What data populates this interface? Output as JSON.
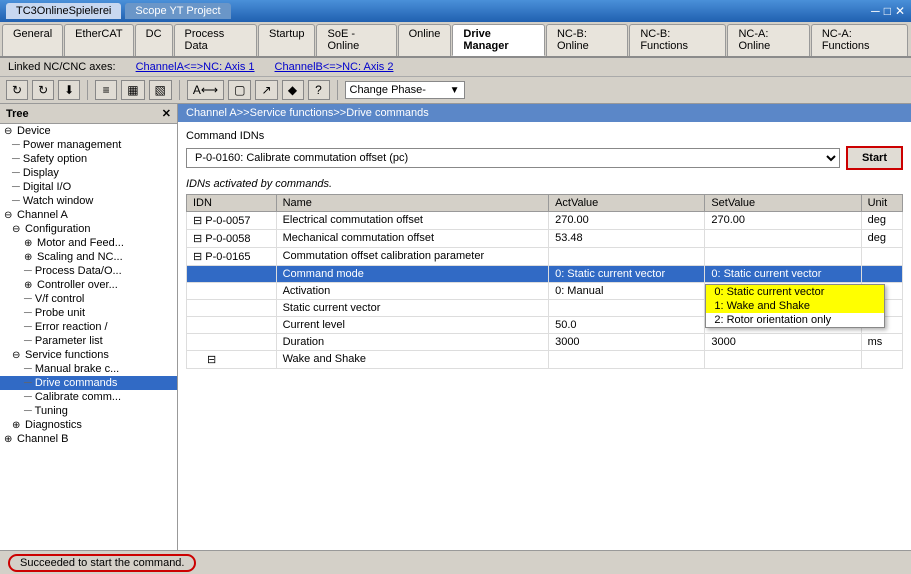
{
  "titlebar": {
    "tab1": "TC3OnlineSpielerei",
    "tab2": "Scope YT Project",
    "close_icon": "✕",
    "minimize_icon": "─",
    "maximize_icon": "□"
  },
  "menuTabs": [
    {
      "label": "General",
      "active": false
    },
    {
      "label": "EtherCAT",
      "active": false
    },
    {
      "label": "DC",
      "active": false
    },
    {
      "label": "Process Data",
      "active": false
    },
    {
      "label": "Startup",
      "active": false
    },
    {
      "label": "SoE - Online",
      "active": false
    },
    {
      "label": "Online",
      "active": false
    },
    {
      "label": "Drive Manager",
      "active": true
    },
    {
      "label": "NC-B: Online",
      "active": false
    },
    {
      "label": "NC-B: Functions",
      "active": false
    },
    {
      "label": "NC-A: Online",
      "active": false
    },
    {
      "label": "NC-A: Functions",
      "active": false
    }
  ],
  "axesBar": {
    "label": "Linked NC/CNC axes:",
    "channelA": "ChannelA<=>NC: Axis 1",
    "channelB": "ChannelB<=>NC: Axis 2"
  },
  "toolbar": {
    "dropdown_label": "Change Phase-",
    "buttons": [
      "↻",
      "↻",
      "⬇",
      "📋",
      "🔲",
      "🔲",
      "A↔",
      "⬜",
      "⬛",
      "🔷",
      "◆",
      "❓"
    ]
  },
  "tree": {
    "header": "Tree",
    "items": [
      {
        "label": "Device",
        "level": 0,
        "expand": true
      },
      {
        "label": "Power management",
        "level": 1
      },
      {
        "label": "Safety option",
        "level": 1
      },
      {
        "label": "Display",
        "level": 1
      },
      {
        "label": "Digital I/O",
        "level": 1
      },
      {
        "label": "Watch window",
        "level": 1
      },
      {
        "label": "Channel A",
        "level": 0,
        "expand": true
      },
      {
        "label": "Configuration",
        "level": 1,
        "expand": true
      },
      {
        "label": "Motor and Feed...",
        "level": 2,
        "expand": true
      },
      {
        "label": "Scaling and NC...",
        "level": 2,
        "expand": true
      },
      {
        "label": "Process Data/O...",
        "level": 2
      },
      {
        "label": "Controller over...",
        "level": 2,
        "expand": true
      },
      {
        "label": "V/f control",
        "level": 2
      },
      {
        "label": "Probe unit",
        "level": 2
      },
      {
        "label": "Error reaction /",
        "level": 2
      },
      {
        "label": "Parameter list",
        "level": 2
      },
      {
        "label": "Service functions",
        "level": 1,
        "expand": true
      },
      {
        "label": "Manual brake c...",
        "level": 2
      },
      {
        "label": "Drive commands",
        "level": 2,
        "selected": true
      },
      {
        "label": "Calibrate comm...",
        "level": 2
      },
      {
        "label": "Tuning",
        "level": 2
      },
      {
        "label": "Diagnostics",
        "level": 1,
        "expand": true
      },
      {
        "label": "Channel B",
        "level": 0
      }
    ]
  },
  "contentHeader": "Channel A>>Service functions>>Drive commands",
  "commandIDNs": {
    "label": "Command IDNs",
    "value": "P-0-0160: Calibrate commutation offset (pc)",
    "startButton": "Start"
  },
  "idnsLabel": "IDNs activated by commands.",
  "tableHeaders": [
    "IDN",
    "Name",
    "ActValue",
    "SetValue",
    "Unit"
  ],
  "tableRows": [
    {
      "idn": "P-0-0057",
      "name": "Electrical commutation offset",
      "actValue": "270.00",
      "setValue": "270.00",
      "unit": "deg",
      "level": 0
    },
    {
      "idn": "P-0-0058",
      "name": "Mechanical commutation offset",
      "actValue": "53.48",
      "setValue": "",
      "unit": "deg",
      "level": 0
    },
    {
      "idn": "P-0-0165",
      "name": "Commutation offset calibration parameter",
      "actValue": "",
      "setValue": "",
      "unit": "",
      "level": 0,
      "expand": true
    },
    {
      "idn": "",
      "name": "Command mode",
      "actValue": "0: Static current vector",
      "setValue": "0: Static current vector",
      "unit": "",
      "level": 1,
      "selected": true,
      "hasDropdown": true
    },
    {
      "idn": "",
      "name": "Activation",
      "actValue": "0: Manual",
      "setValue": "",
      "unit": "",
      "level": 1
    },
    {
      "idn": "",
      "name": "Static current vector",
      "actValue": "",
      "setValue": "",
      "unit": "",
      "level": 1,
      "expand": true
    },
    {
      "idn": "",
      "name": "Current level",
      "actValue": "50.0",
      "setValue": "50.0",
      "unit": "%",
      "level": 2
    },
    {
      "idn": "",
      "name": "Duration",
      "actValue": "3000",
      "setValue": "3000",
      "unit": "ms",
      "level": 2
    },
    {
      "idn": "",
      "name": "Wake and Shake",
      "actValue": "",
      "setValue": "",
      "unit": "",
      "level": 1,
      "expand": true
    }
  ],
  "dropdownOptions": [
    {
      "label": "0: Static current vector",
      "selected": true
    },
    {
      "label": "1: Wake and Shake",
      "selected": false
    },
    {
      "label": "2: Rotor orientation only",
      "selected": false
    }
  ],
  "statusBar": {
    "message": "Succeeded to start the command."
  }
}
